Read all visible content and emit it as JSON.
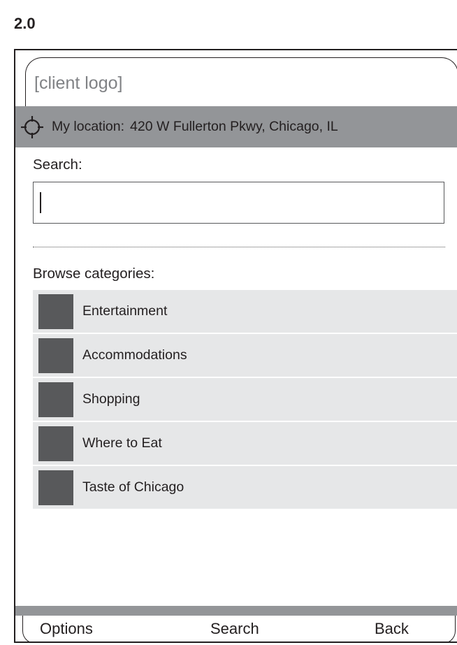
{
  "version": "2.0",
  "header": {
    "logo_placeholder": "[client logo]"
  },
  "location": {
    "icon": "crosshair-icon",
    "label": "My location:",
    "address": "420 W Fullerton Pkwy, Chicago, IL"
  },
  "search": {
    "label": "Search:",
    "value": ""
  },
  "browse": {
    "label": "Browse categories:",
    "categories": [
      {
        "label": "Entertainment"
      },
      {
        "label": "Accommodations"
      },
      {
        "label": "Shopping"
      },
      {
        "label": "Where to Eat"
      },
      {
        "label": "Taste of Chicago"
      }
    ]
  },
  "softkeys": {
    "left": "Options",
    "center": "Search",
    "right": "Back"
  },
  "colors": {
    "bar_gray": "#939598",
    "item_bg": "#e6e7e8",
    "thumb": "#58595b"
  }
}
